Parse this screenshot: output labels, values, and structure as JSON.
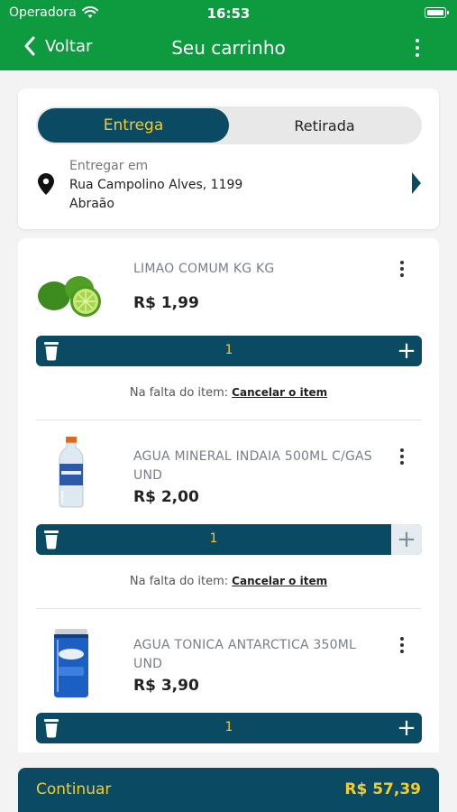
{
  "status_bar": {
    "carrier": "Operadora",
    "time": "16:53"
  },
  "header": {
    "back_label": "Voltar",
    "title": "Seu carrinho"
  },
  "delivery": {
    "tabs": [
      {
        "label": "Entrega",
        "active": true
      },
      {
        "label": "Retirada",
        "active": false
      }
    ],
    "address_label": "Entregar em",
    "address_line1": "Rua Campolino Alves, 1199",
    "address_line2": "Abraão"
  },
  "cart": {
    "shortage_label": "Na falta do item:",
    "shortage_action": "Cancelar o item",
    "items": [
      {
        "name": "LIMAO COMUM KG KG",
        "price": "R$ 1,99",
        "quantity": "1",
        "image_icon": "lime-icon"
      },
      {
        "name": "AGUA MINERAL INDAIA 500ML C/GAS UND",
        "price": "R$ 2,00",
        "quantity": "1",
        "image_icon": "water-bottle-icon"
      },
      {
        "name": "AGUA TONICA ANTARCTICA 350ML UND",
        "price": "R$ 3,90",
        "quantity": "1",
        "image_icon": "tonic-can-icon"
      }
    ]
  },
  "footer": {
    "continue_label": "Continuar",
    "total": "R$ 57,39"
  },
  "colors": {
    "header_green": "#0e9a3f",
    "primary_navy": "#0a4a63",
    "accent_yellow": "#f5cc2a"
  }
}
